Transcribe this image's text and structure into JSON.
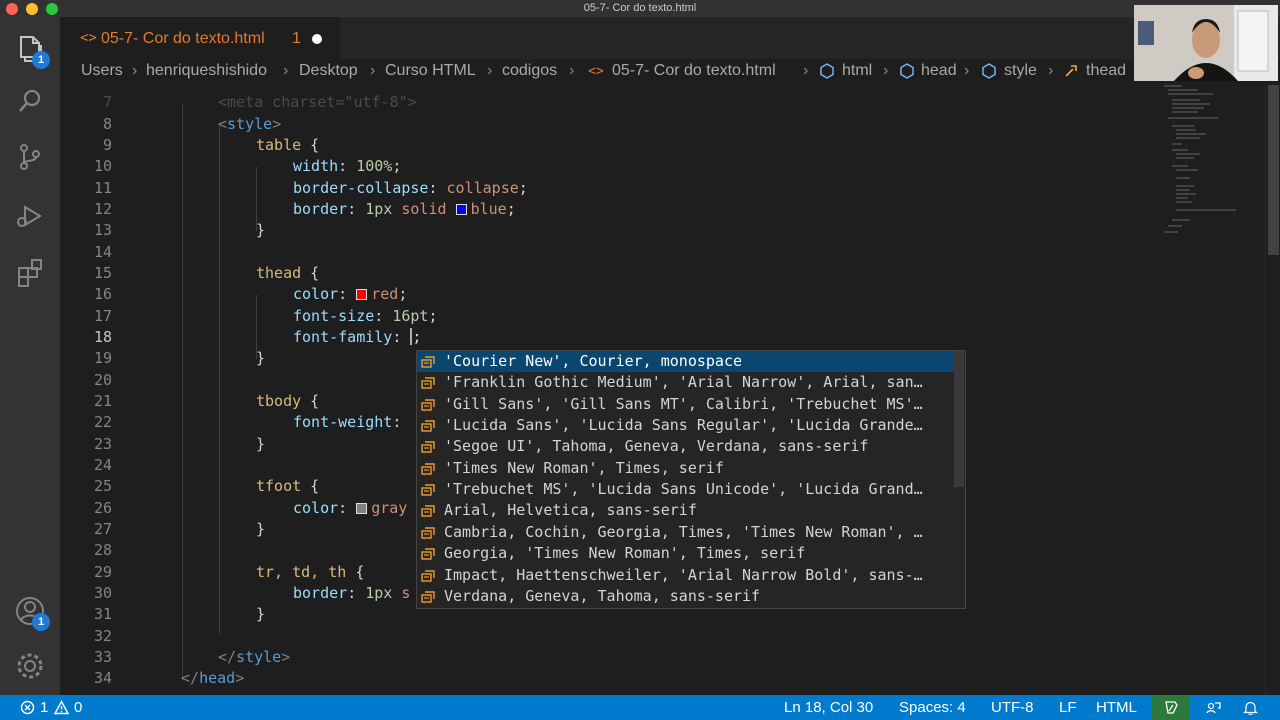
{
  "window": {
    "title": "05-7- Cor do texto.html"
  },
  "tab": {
    "icon": "<>",
    "label": "05-7- Cor do texto.html",
    "problems": "1"
  },
  "breadcrumb": [
    "Users",
    "henriqueshishido",
    "Desktop",
    "Curso HTML",
    "codigos",
    "05-7- Cor do texto.html",
    "html",
    "head",
    "style",
    "thead"
  ],
  "activity": {
    "explorer_badge": "1",
    "accounts_badge": "1",
    "icons": [
      "files-icon",
      "search-icon",
      "source-control-icon",
      "run-debug-icon",
      "extensions-icon",
      "account-icon",
      "settings-gear-icon"
    ]
  },
  "code": {
    "line_numbers": [
      "7",
      "8",
      "9",
      "10",
      "11",
      "12",
      "13",
      "14",
      "15",
      "16",
      "17",
      "18",
      "19",
      "20",
      "21",
      "22",
      "23",
      "24",
      "25",
      "26",
      "27",
      "28",
      "29",
      "30",
      "31",
      "32",
      "33",
      "34"
    ],
    "line7": "<meta charset=\"utf-8\">",
    "l8_tag": "style",
    "l9_sel": "table",
    "l10_prop": "width",
    "l10_val": "100%",
    "l11_prop": "border-collapse",
    "l11_val": "collapse",
    "l12_prop": "border",
    "l12_num": "1px",
    "l12_val1": "solid",
    "l12_val2": "blue",
    "l15_sel": "thead",
    "l16_prop": "color",
    "l16_val": "red",
    "l17_prop": "font-size",
    "l17_val": "16pt",
    "l18_prop": "font-family",
    "l21_sel": "tbody",
    "l22_prop": "font-weight",
    "l25_sel": "tfoot",
    "l26_prop": "color",
    "l26_val": "gray",
    "l29_sel": "tr, td, th",
    "l30_prop": "border",
    "l30_num": "1px",
    "l30_val": "s",
    "l33_tag": "style",
    "l34_tag": "head"
  },
  "swatches": {
    "blue": "#0000ff",
    "red": "#ff0000",
    "gray": "#808080"
  },
  "suggestions": [
    "'Courier New', Courier, monospace",
    "'Franklin Gothic Medium', 'Arial Narrow', Arial, san…",
    "'Gill Sans', 'Gill Sans MT', Calibri, 'Trebuchet MS'…",
    "'Lucida Sans', 'Lucida Sans Regular', 'Lucida Grande…",
    "'Segoe UI', Tahoma, Geneva, Verdana, sans-serif",
    "'Times New Roman', Times, serif",
    "'Trebuchet MS', 'Lucida Sans Unicode', 'Lucida Grand…",
    "Arial, Helvetica, sans-serif",
    "Cambria, Cochin, Georgia, Times, 'Times New Roman', …",
    "Georgia, 'Times New Roman', Times, serif",
    "Impact, Haettenschweiler, 'Arial Narrow Bold', sans-…",
    "Verdana, Geneva, Tahoma, sans-serif"
  ],
  "status": {
    "errors": "1",
    "warnings": "0",
    "position": "Ln 18, Col 30",
    "spaces": "Spaces: 4",
    "encoding": "UTF-8",
    "eol": "LF",
    "language": "HTML"
  },
  "colors": {
    "statusbar": "#007acc",
    "accent": "#e37933",
    "selection": "#094771"
  }
}
